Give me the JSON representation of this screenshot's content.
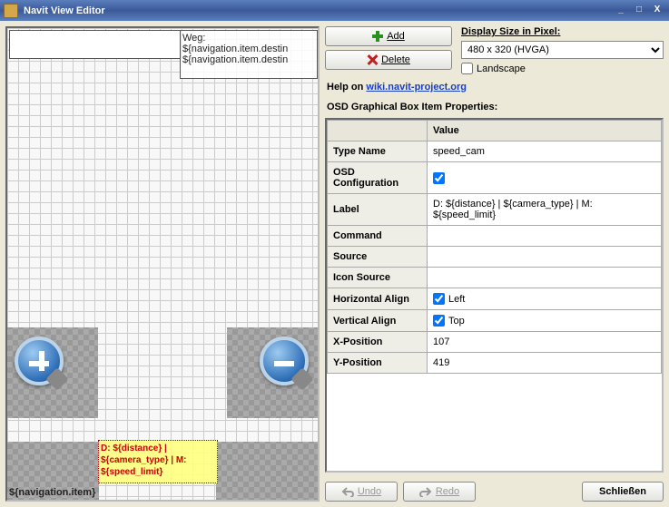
{
  "window": {
    "title": "Navit View Editor"
  },
  "toolbar": {
    "add": "Add",
    "delete": "Delete"
  },
  "display": {
    "label": "Display Size in Pixel:",
    "options": [
      "480 x 320 (HVGA)"
    ],
    "selected": "480 x 320 (HVGA)",
    "landscape": "Landscape"
  },
  "help": {
    "prefix": "Help on ",
    "link_text": "wiki.navit-project.org"
  },
  "props": {
    "heading": "OSD Graphical Box Item Properties:",
    "col_value": "Value",
    "rows": {
      "type_name": {
        "name": "Type Name",
        "value": "speed_cam"
      },
      "osd_config": {
        "name": "OSD Configuration",
        "checked": true
      },
      "label": {
        "name": "Label",
        "value": "D: ${distance} | ${camera_type} | M: ${speed_limit}"
      },
      "command": {
        "name": "Command",
        "value": ""
      },
      "source": {
        "name": "Source",
        "value": ""
      },
      "icon_source": {
        "name": "Icon Source",
        "value": ""
      },
      "h_align": {
        "name": "Horizontal Align",
        "checked": true,
        "text": "Left"
      },
      "v_align": {
        "name": "Vertical Align",
        "checked": true,
        "text": "Top"
      },
      "x_pos": {
        "name": "X-Position",
        "value": "107"
      },
      "y_pos": {
        "name": "Y-Position",
        "value": "419"
      }
    }
  },
  "canvas": {
    "top_overlay": "Weg:\n${navigation.item.destin\n${navigation.item.destin",
    "highlight": "D: ${distance} |\n${camera_type} | M:\n${speed_limit}",
    "nav_item": "${navigation.item}"
  },
  "footer": {
    "undo": "Undo",
    "redo": "Redo",
    "close": "Schließen"
  }
}
